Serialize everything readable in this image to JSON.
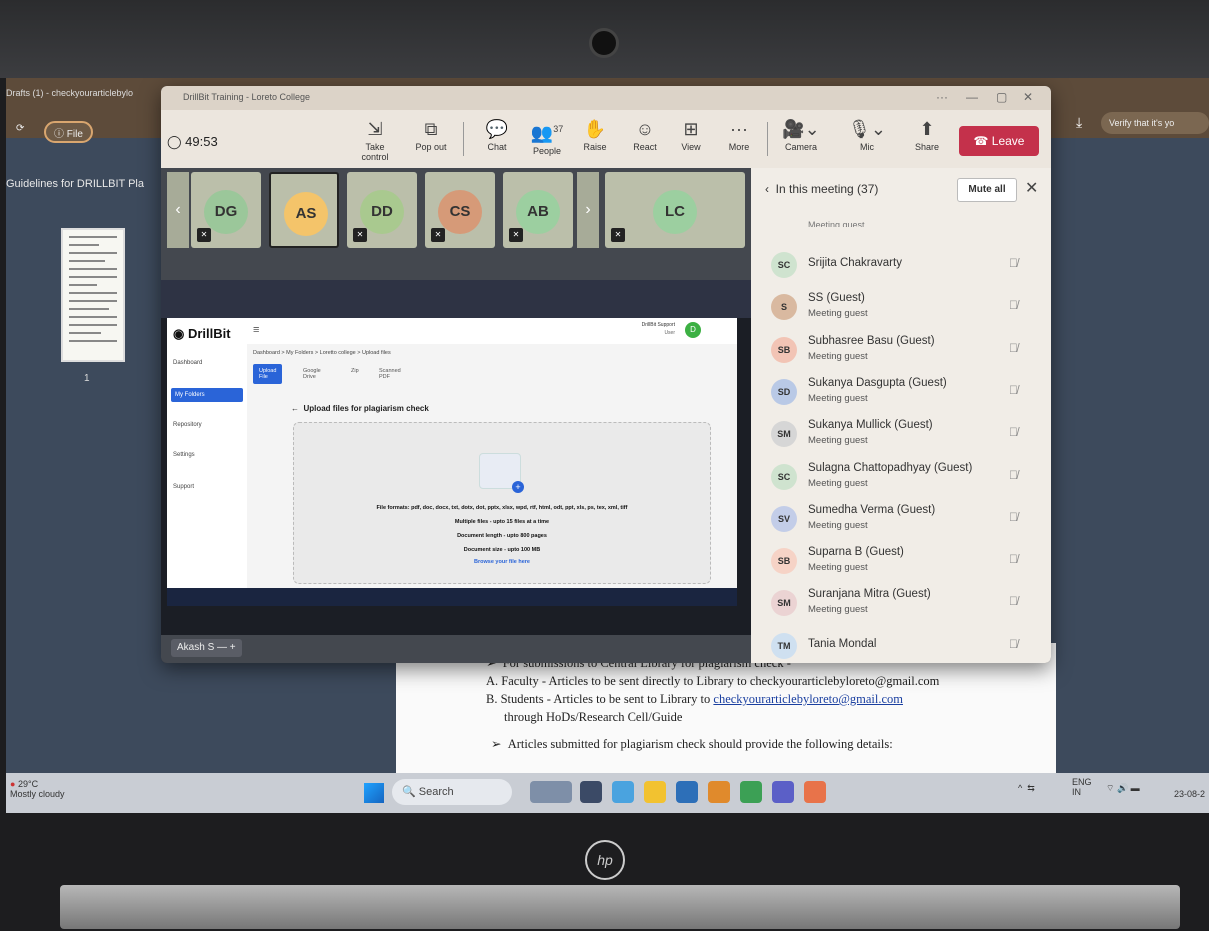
{
  "browser": {
    "tab_title": "Drafts (1) - checkyourarticlebylo",
    "file_label": "File",
    "verify_label": "Verify that it's yo",
    "pdf_title": "Guidelines for DRILLBIT Pla",
    "page_number": "1"
  },
  "teams": {
    "window_title": "DrillBit Training - Loreto College",
    "timer": "49:53",
    "toolbar": [
      {
        "label": "Take control",
        "icon": "take-control-icon"
      },
      {
        "label": "Pop out",
        "icon": "pop-out-icon"
      },
      {
        "label": "Chat",
        "icon": "chat-icon"
      },
      {
        "label": "People",
        "icon": "people-icon",
        "badge": "37"
      },
      {
        "label": "Raise",
        "icon": "raise-hand-icon"
      },
      {
        "label": "React",
        "icon": "react-icon"
      },
      {
        "label": "View",
        "icon": "view-icon"
      },
      {
        "label": "More",
        "icon": "more-icon"
      },
      {
        "label": "Camera",
        "icon": "camera-icon"
      },
      {
        "label": "Mic",
        "icon": "mic-icon"
      },
      {
        "label": "Share",
        "icon": "share-icon"
      }
    ],
    "leave_label": "Leave",
    "tiles": [
      {
        "initials": "DG",
        "color": "#9bc79a"
      },
      {
        "initials": "AS",
        "color": "#f4c46a"
      },
      {
        "initials": "DD",
        "color": "#a9c98f"
      },
      {
        "initials": "CS",
        "color": "#d69a78"
      },
      {
        "initials": "AB",
        "color": "#9ccfa0"
      },
      {
        "initials": "LC",
        "color": "#9ccfa0"
      }
    ],
    "presenter_name": "Akash S"
  },
  "drillbit": {
    "logo": "DrillBit",
    "user": "DrillBit Support",
    "user_role": "User",
    "nav": [
      "Dashboard",
      "My Folders",
      "Repository",
      "Settings",
      "Support"
    ],
    "breadcrumb": "Dashboard > My Folders > Loretto college > Upload files",
    "tabs": [
      "Upload File",
      "Google Drive",
      "Zip",
      "Scanned PDF"
    ],
    "upload_title": "Upload files for plagiarism check",
    "formats": "File formats: pdf, doc, docx, txt, dotx, dot, pptx, xlsx, wpd, rtf, html, odt, ppt, xls, ps, tex, xml, tiff",
    "multiple": "Multiple files - upto 15 files at a time",
    "length": "Document length - upto 800 pages",
    "size": "Document size - upto 100 MB",
    "browse": "Browse your file here"
  },
  "people_panel": {
    "header": "In this meeting (37)",
    "mute_all": "Mute all",
    "top_fragment": "Meeting guest",
    "participants": [
      {
        "initials": "SC",
        "name": "Srijita Chakravarty",
        "sub": "",
        "color": "#cfe3cf"
      },
      {
        "initials": "S",
        "name": "SS (Guest)",
        "sub": "Meeting guest",
        "color": "#d9b9a0"
      },
      {
        "initials": "SB",
        "name": "Subhasree Basu (Guest)",
        "sub": "Meeting guest",
        "color": "#f2c4b5"
      },
      {
        "initials": "SD",
        "name": "Sukanya Dasgupta (Guest)",
        "sub": "Meeting guest",
        "color": "#b9c9e6"
      },
      {
        "initials": "SM",
        "name": "Sukanya Mullick (Guest)",
        "sub": "Meeting guest",
        "color": "#d6d6d6"
      },
      {
        "initials": "SC",
        "name": "Sulagna Chattopadhyay (Guest)",
        "sub": "Meeting guest",
        "color": "#cfe3cf"
      },
      {
        "initials": "SV",
        "name": "Sumedha Verma (Guest)",
        "sub": "Meeting guest",
        "color": "#c3cde8"
      },
      {
        "initials": "SB",
        "name": "Suparna B (Guest)",
        "sub": "Meeting guest",
        "color": "#f6d3c6"
      },
      {
        "initials": "SM",
        "name": "Suranjana Mitra (Guest)",
        "sub": "Meeting guest",
        "color": "#ebd3d3"
      },
      {
        "initials": "TM",
        "name": "Tania Mondal",
        "sub": "",
        "color": "#cfe0f0"
      }
    ]
  },
  "pdf_text": {
    "line1": "For submissions to Central Library for plagiarism check -",
    "line2": "A.  Faculty - Articles to be sent directly to Library to checkyourarticlebyloreto@gmail.com",
    "line3_prefix": "B.  Students - Articles to be sent to Library to ",
    "line3_link": "checkyourarticlebyloreto@gmail.com",
    "line4": "through HoDs/Research Cell/Guide",
    "line5": "Articles submitted for plagiarism check should provide the following details:"
  },
  "taskbar": {
    "temp": "29°C",
    "weather": "Mostly cloudy",
    "search": "Search",
    "lang": "ENG",
    "region": "IN",
    "date": "23-08-2"
  },
  "laptop": {
    "brand": "hp"
  }
}
